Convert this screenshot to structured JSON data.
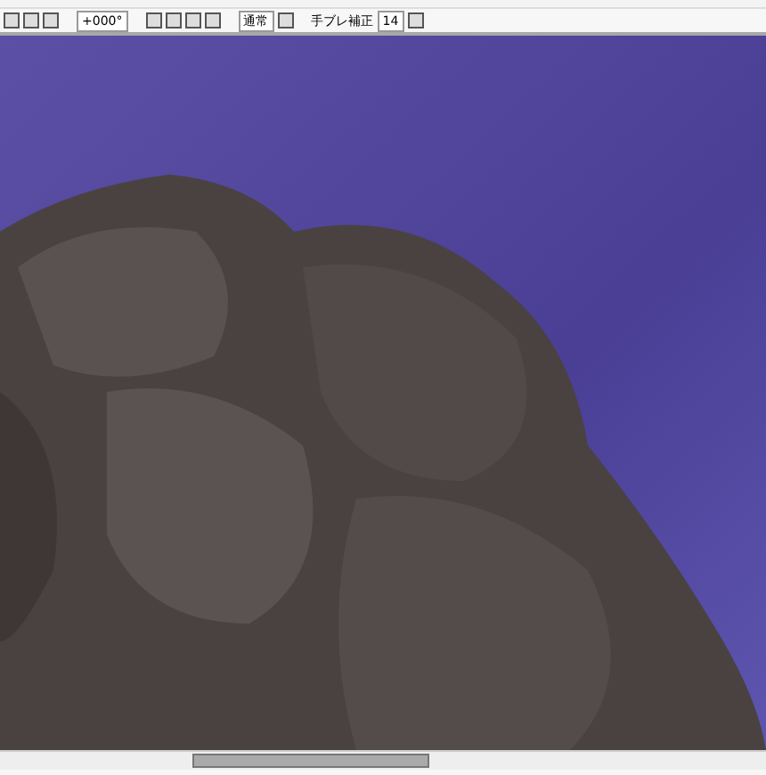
{
  "toolbar": {
    "rotation": {
      "value": "+000°"
    },
    "blend_mode": {
      "value": "通常"
    },
    "stabilizer": {
      "label": "手ブレ補正",
      "value": "14"
    }
  }
}
